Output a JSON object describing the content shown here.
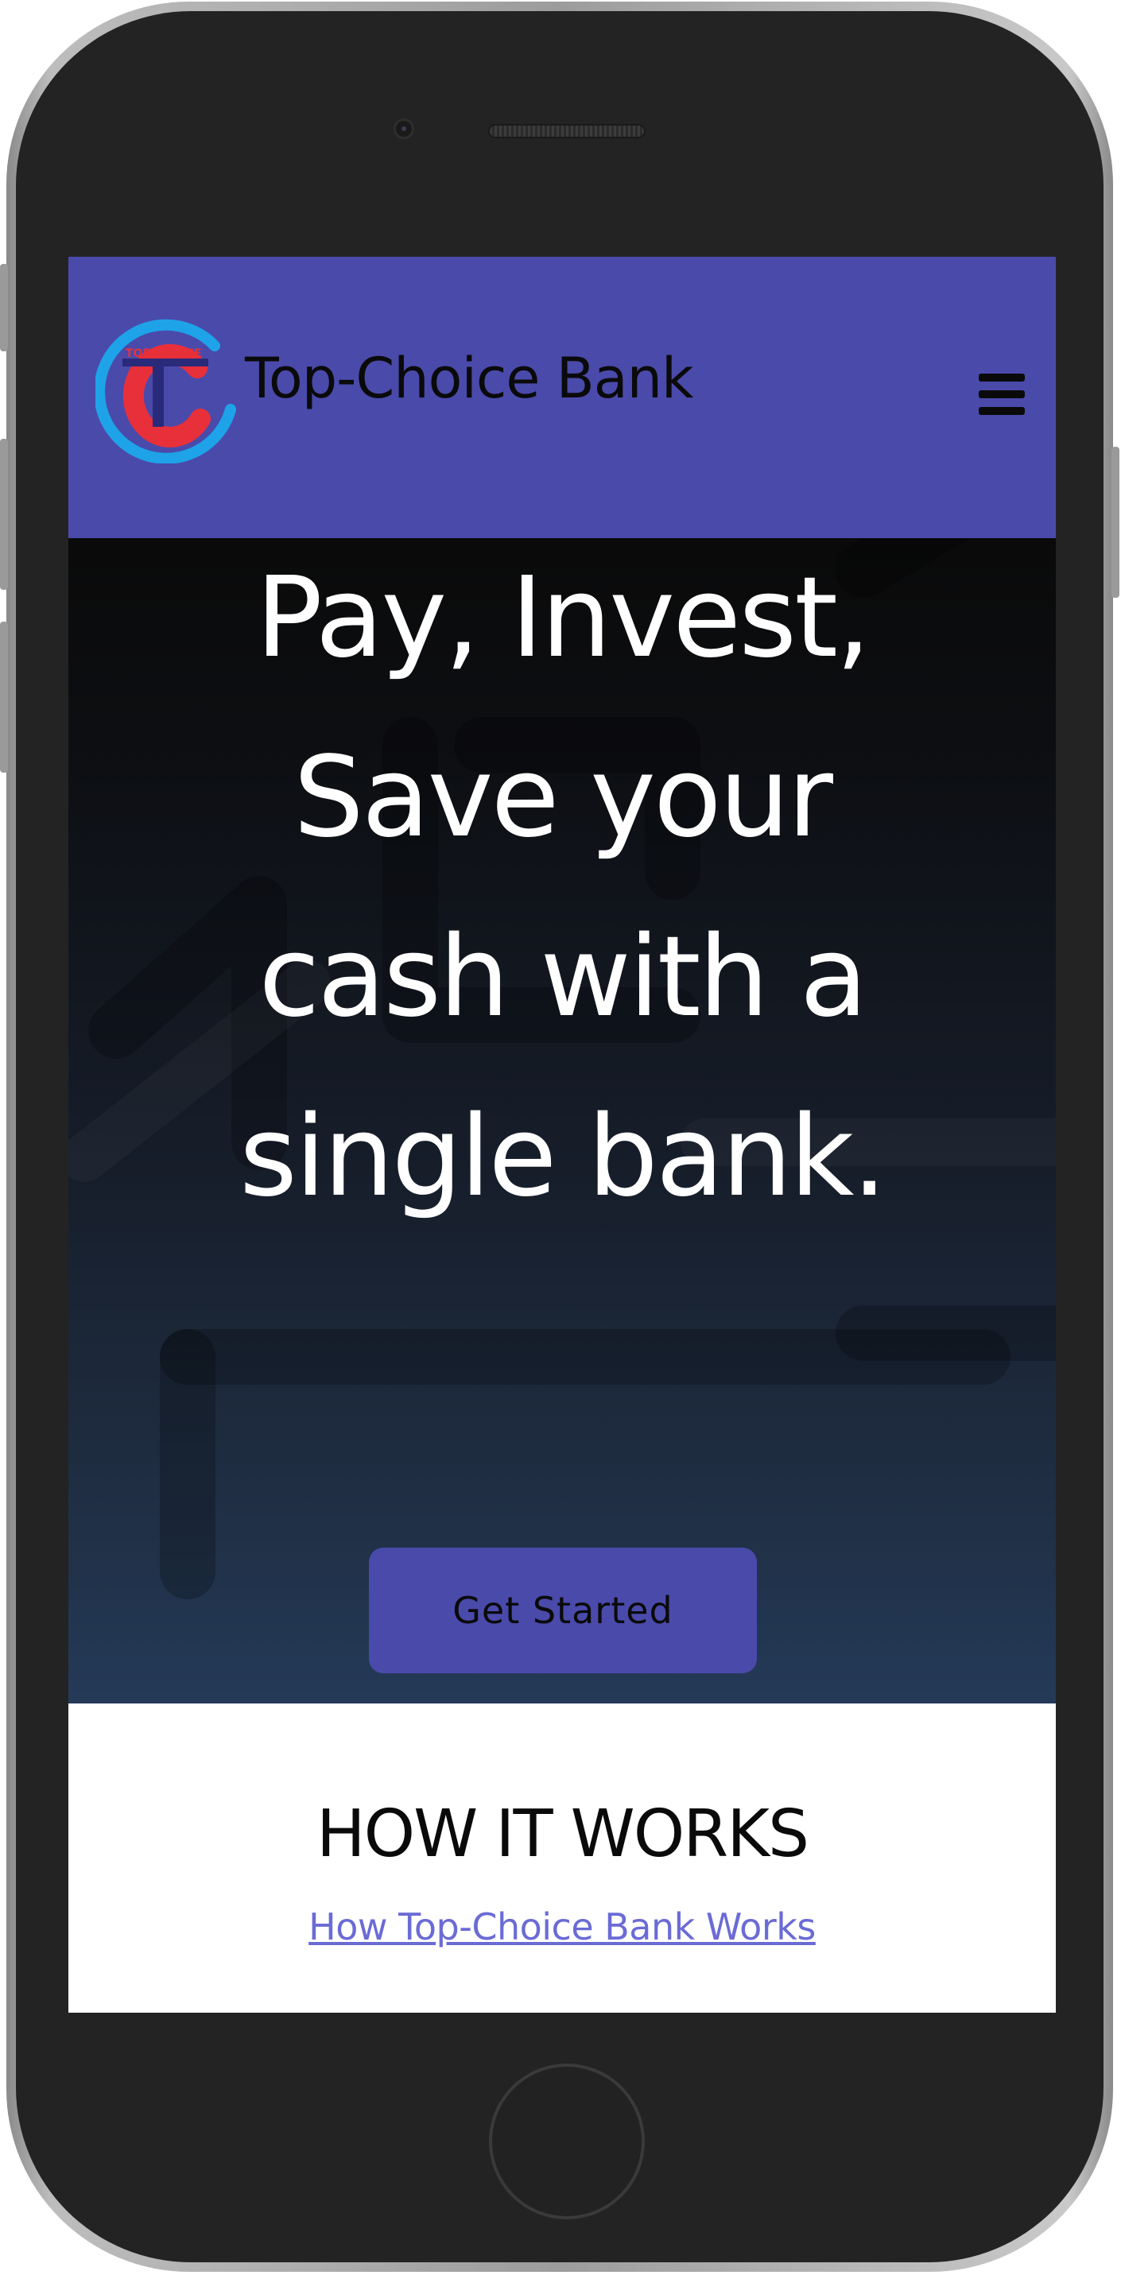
{
  "navbar": {
    "brand": "Top-Choice Bank",
    "logo_text": "TOP CHOICE",
    "logo_letters": "TC",
    "menu_icon": "hamburger-icon",
    "background_color": "#4a4aab"
  },
  "hero": {
    "headline_lines": [
      "Pay, Invest,",
      "Save your",
      "cash with a",
      "single bank."
    ],
    "cta_label": "Get Started",
    "cta_color": "#4a4aab"
  },
  "how_it_works": {
    "title": "HOW IT WORKS",
    "link_text": "How Top-Choice Bank Works",
    "link_color": "#6b6bd6"
  },
  "colors": {
    "accent": "#4a4aab",
    "device_frame": "#232323",
    "logo_red": "#e8303a",
    "logo_blue": "#1fa3e8"
  }
}
